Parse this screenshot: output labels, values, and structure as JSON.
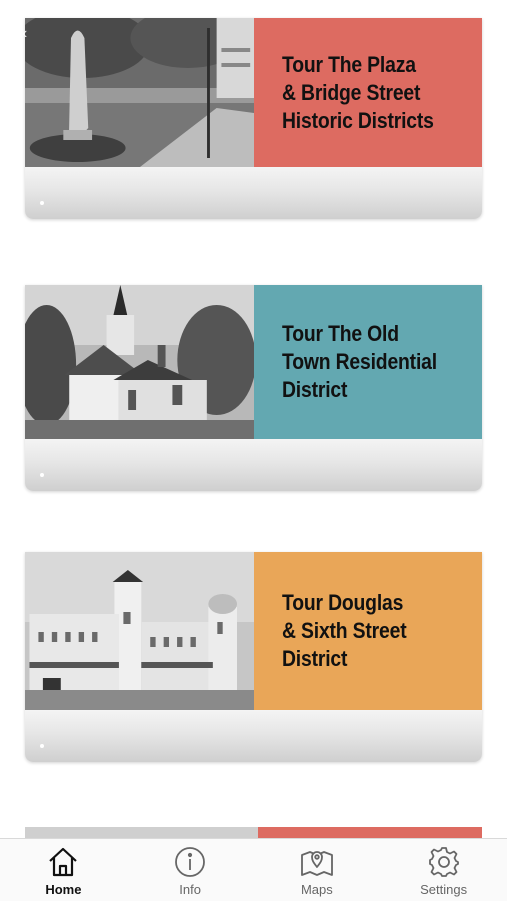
{
  "cards": [
    {
      "title": "Tour The Plaza\n& Bridge Street\nHistoric Districts",
      "color": "#dd6b61",
      "photo": "statue-park-photo"
    },
    {
      "title": "Tour The Old\nTown Residential\nDistrict",
      "color": "#63a8b1",
      "photo": "church-photo"
    },
    {
      "title": "Tour Douglas\n& Sixth Street\nDistrict",
      "color": "#e9a658",
      "photo": "historic-building-photo"
    }
  ],
  "partial_card": {
    "color": "#dd6b61"
  },
  "tabs": [
    {
      "label": "Home",
      "icon": "home-icon",
      "active": true
    },
    {
      "label": "Info",
      "icon": "info-icon",
      "active": false
    },
    {
      "label": "Maps",
      "icon": "map-icon",
      "active": false
    },
    {
      "label": "Settings",
      "icon": "gear-icon",
      "active": false
    }
  ],
  "colors": {
    "active_tab": "#111111",
    "inactive_tab": "#666666"
  }
}
